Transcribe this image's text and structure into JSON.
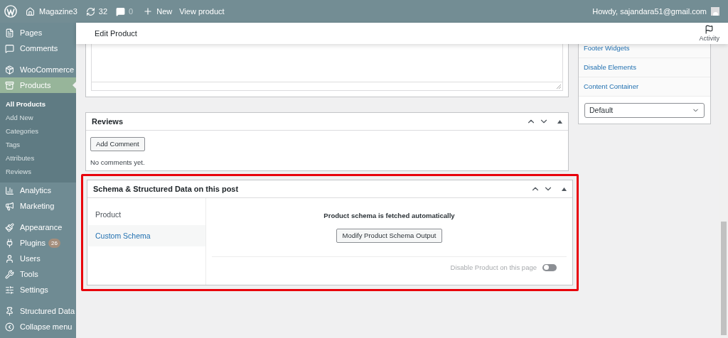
{
  "admin_bar": {
    "site": "Magazine3",
    "updates": "32",
    "comments": "0",
    "new": "New",
    "view": "View product",
    "greeting": "Howdy, sajandara51@gmail.com"
  },
  "sidebar": {
    "items": [
      {
        "label": "Pages",
        "selected": false
      },
      {
        "label": "Comments",
        "selected": false
      },
      {
        "label": "WooCommerce",
        "selected": false
      },
      {
        "label": "Products",
        "selected": true,
        "children": [
          {
            "label": "All Products",
            "selected": true
          },
          {
            "label": "Add New",
            "selected": false
          },
          {
            "label": "Categories",
            "selected": false
          },
          {
            "label": "Tags",
            "selected": false
          },
          {
            "label": "Attributes",
            "selected": false
          },
          {
            "label": "Reviews",
            "selected": false
          }
        ]
      },
      {
        "label": "Analytics",
        "selected": false
      },
      {
        "label": "Marketing",
        "selected": false
      },
      {
        "label": "Appearance",
        "selected": false
      },
      {
        "label": "Plugins",
        "selected": false,
        "badge": "26"
      },
      {
        "label": "Users",
        "selected": false
      },
      {
        "label": "Tools",
        "selected": false
      },
      {
        "label": "Settings",
        "selected": false
      },
      {
        "label": "Structured Data",
        "selected": false
      },
      {
        "label": "Collapse menu",
        "selected": false
      }
    ]
  },
  "header": {
    "title": "Edit Product",
    "activity": "Activity"
  },
  "reviews": {
    "title": "Reviews",
    "button": "Add Comment",
    "empty": "No comments yet."
  },
  "schema": {
    "title": "Schema & Structured Data on this post",
    "tabs": [
      {
        "label": "Product",
        "selected": true
      },
      {
        "label": "Custom Schema",
        "selected": false
      }
    ],
    "message": "Product schema is fetched automatically",
    "button": "Modify Product Schema Output",
    "toggle_label": "Disable Product on this page",
    "on": false
  },
  "side_panel": {
    "links": [
      "Footer Widgets",
      "Disable Elements",
      "Content Container"
    ],
    "select": "Default"
  }
}
